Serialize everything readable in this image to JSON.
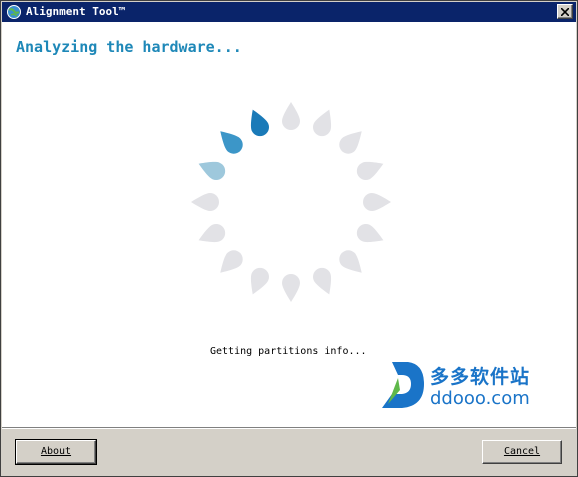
{
  "window": {
    "title": "Alignment Tool™",
    "app_icon": "app-globe-icon",
    "close_icon": "close-icon"
  },
  "main": {
    "heading": "Analyzing the hardware...",
    "status": "Getting partitions info...",
    "spinner": {
      "petal_count": 16,
      "colors": {
        "active": "#1a7ab8",
        "trail_1": "#3c96c8",
        "trail_2": "#9ec8dc",
        "inactive": "#e2e2e6"
      }
    }
  },
  "watermark": {
    "cn_text": "多多软件站",
    "en_text": "ddooo.com",
    "color": "#1a74c8"
  },
  "footer": {
    "about_label": "About",
    "cancel_label": "Cancel"
  }
}
